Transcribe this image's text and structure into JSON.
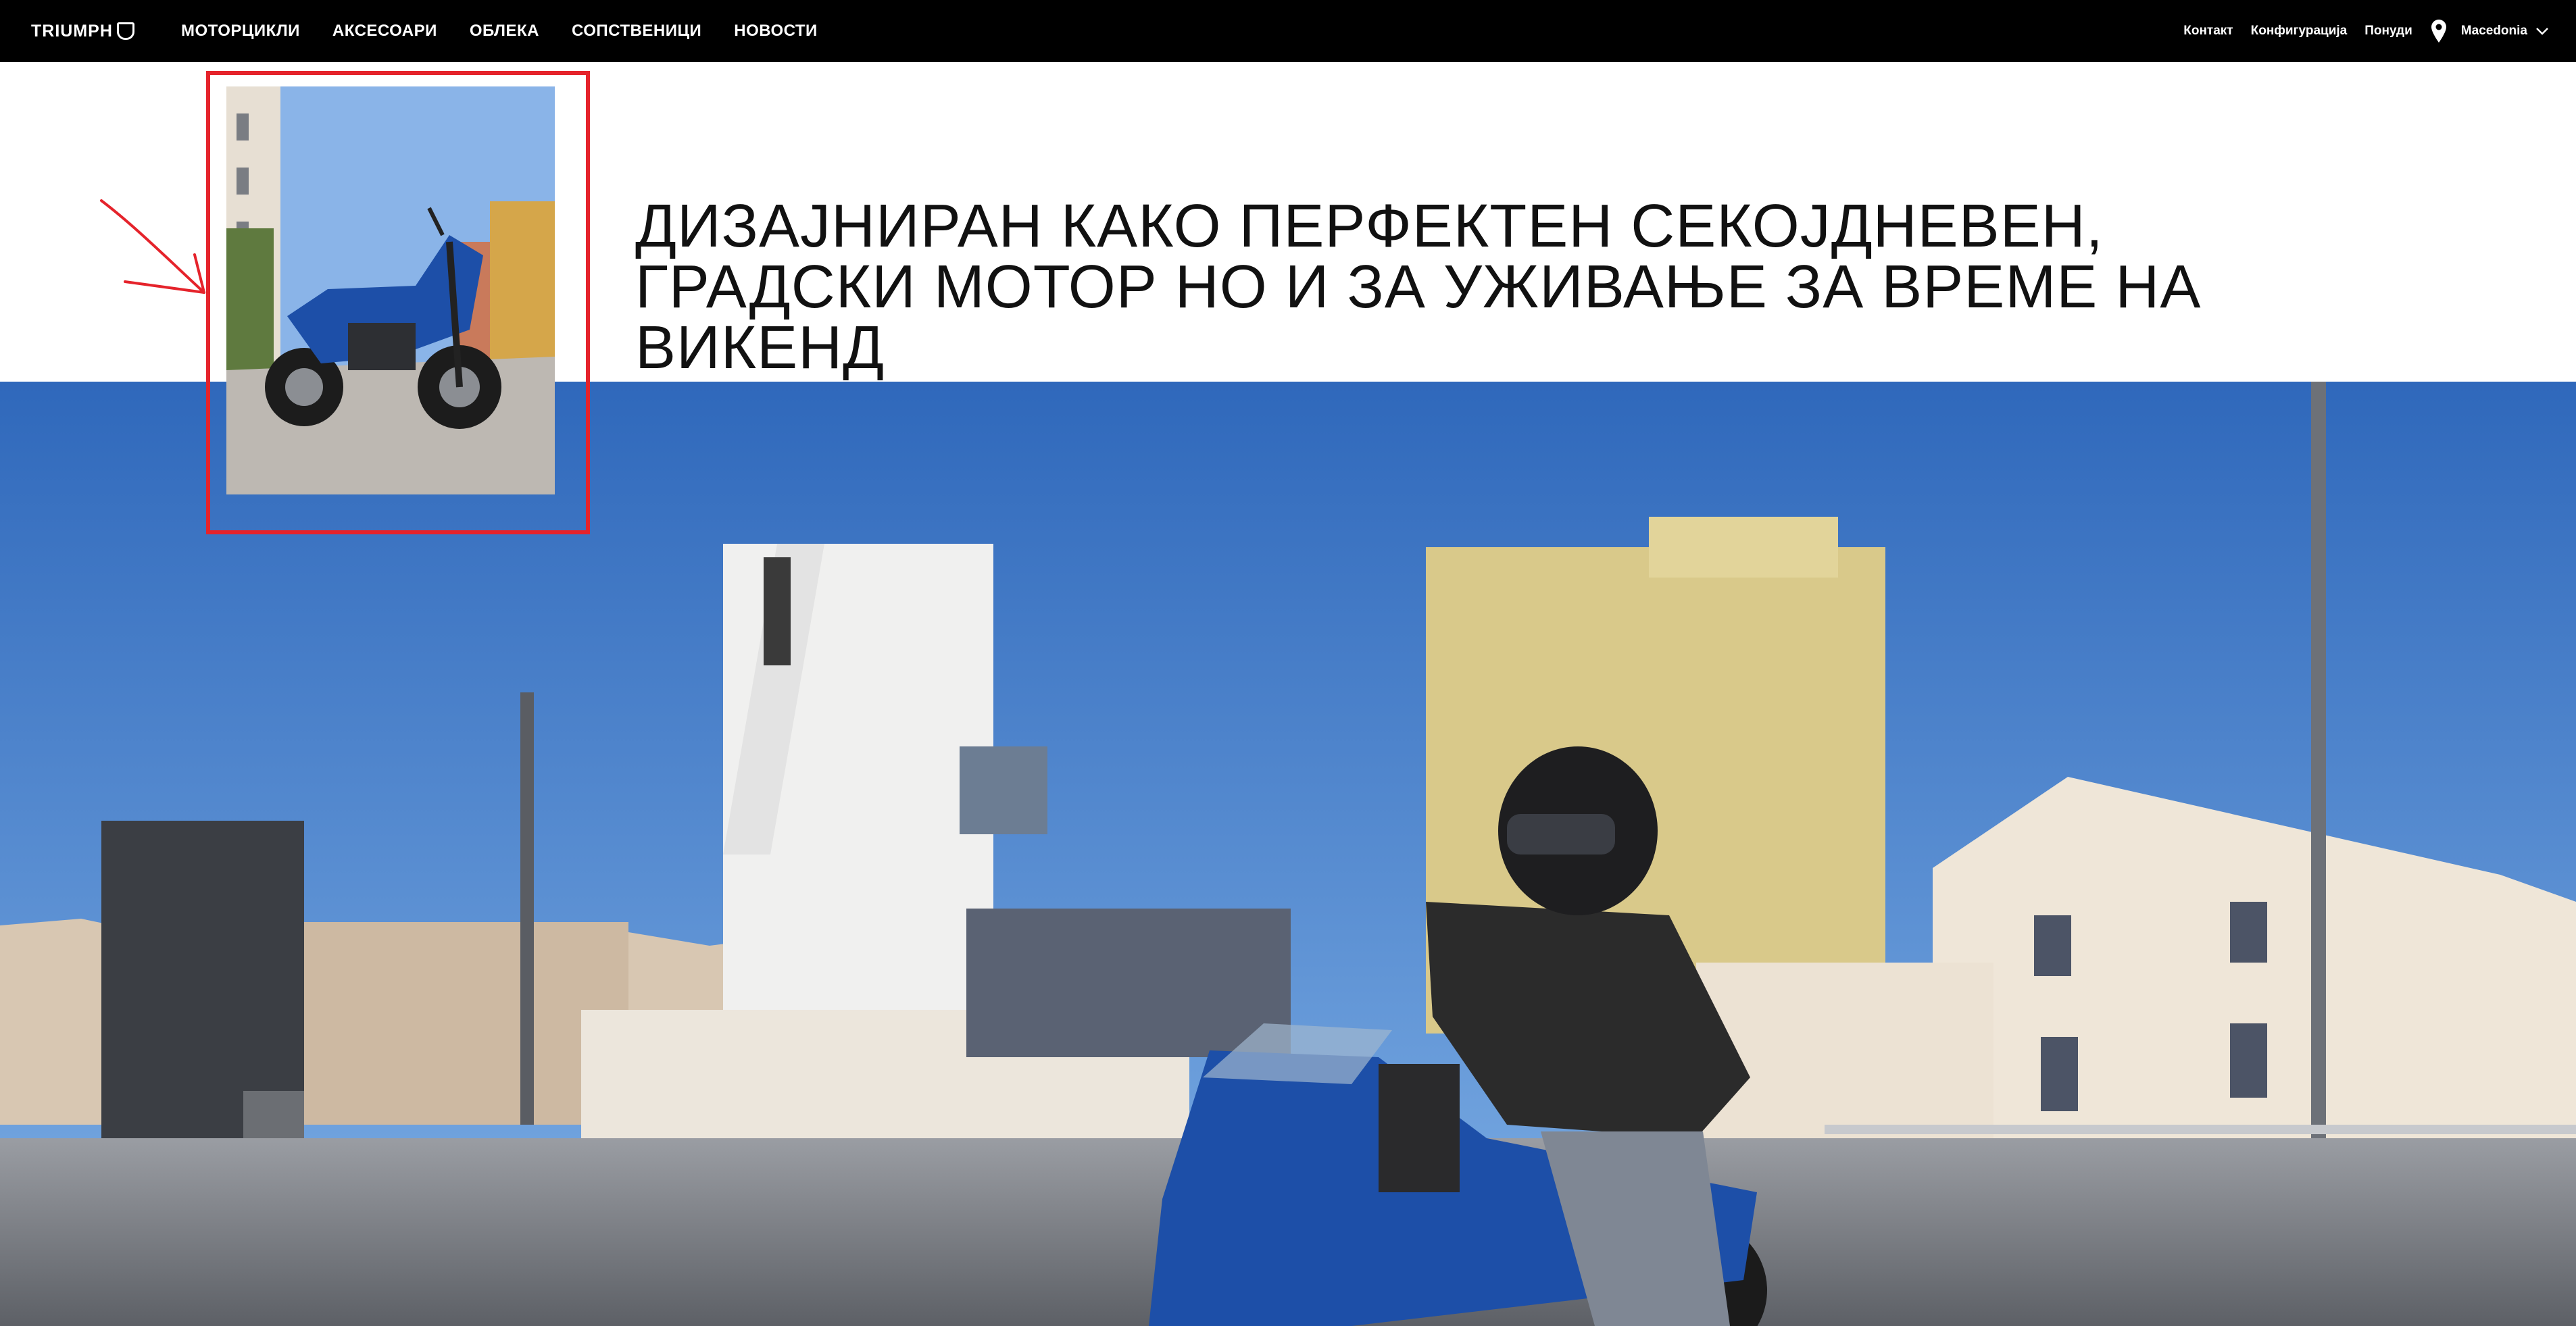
{
  "nav": {
    "brand": "TRIUMPH",
    "main_items": [
      "МОТОРЦИКЛИ",
      "АКСЕСОАРИ",
      "ОБЛЕКА",
      "СОПСТВЕНИЦИ",
      "НОВОСТИ"
    ],
    "utility_items": [
      "Контакт",
      "Конфигурација",
      "Понуди"
    ],
    "region": "Macedonia"
  },
  "headline": {
    "line1": "ДИЗАЈНИРАН КАКО ПЕРФЕКТЕН СЕКОЈДНЕВЕН,",
    "line2": "ГРАДСКИ МОТОР НО И ЗА УЖИВАЊЕ ЗА ВРЕМЕ НА",
    "line3": "ВИКЕНД"
  },
  "colors": {
    "nav_bg": "#000000",
    "nav_text": "#ffffff",
    "annotation": "#e5232b",
    "motorcycle_blue": "#1d4fa8",
    "sky": "#3d78c9"
  },
  "icons": {
    "region": "map-pin-icon",
    "dropdown": "chevron-down-icon",
    "logo": "triumph-logo"
  }
}
